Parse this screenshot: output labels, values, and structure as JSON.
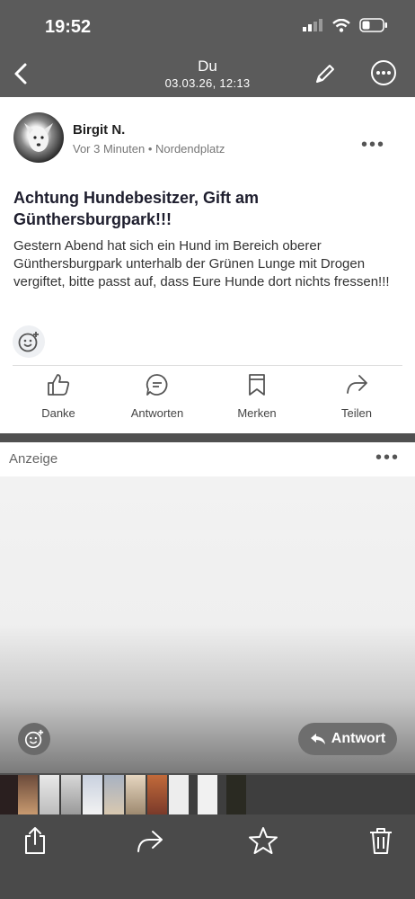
{
  "status": {
    "time": "19:52"
  },
  "nav": {
    "title": "Du",
    "subtitle": "03.03.26, 12:13"
  },
  "post": {
    "author": "Birgit N.",
    "meta": "Vor 3 Minuten • Nordendplatz",
    "title": "Achtung Hundebesitzer, Gift am Günthersburgpark!!!",
    "body": "Gestern Abend hat sich ein Hund im Bereich oberer Günthersburgpark unterhalb der Grünen Lunge mit Drogen vergiftet, bitte passt auf, dass Eure Hunde dort nichts fressen!!!",
    "actions": [
      "Danke",
      "Antworten",
      "Merken",
      "Teilen"
    ]
  },
  "ad": {
    "label": "Anzeige"
  },
  "reply": {
    "label": "Antwort"
  },
  "colors": {
    "bar": "#5b5b5b",
    "toolbar": "#4a4a4a",
    "card": "#ffffff",
    "title": "#1e1e2e"
  },
  "icons": {
    "back": "chevron-left-icon",
    "edit": "pencil-icon",
    "more": "more-circle-icon",
    "danke": "thumbs-up-icon",
    "antworten": "chat-bubble-icon",
    "merken": "bookmark-icon",
    "teilen": "share-arrow-icon",
    "emoji": "add-emoji-icon",
    "reply": "reply-arrow-icon",
    "toolbar": [
      "share-icon",
      "forward-icon",
      "star-icon",
      "trash-icon"
    ]
  }
}
